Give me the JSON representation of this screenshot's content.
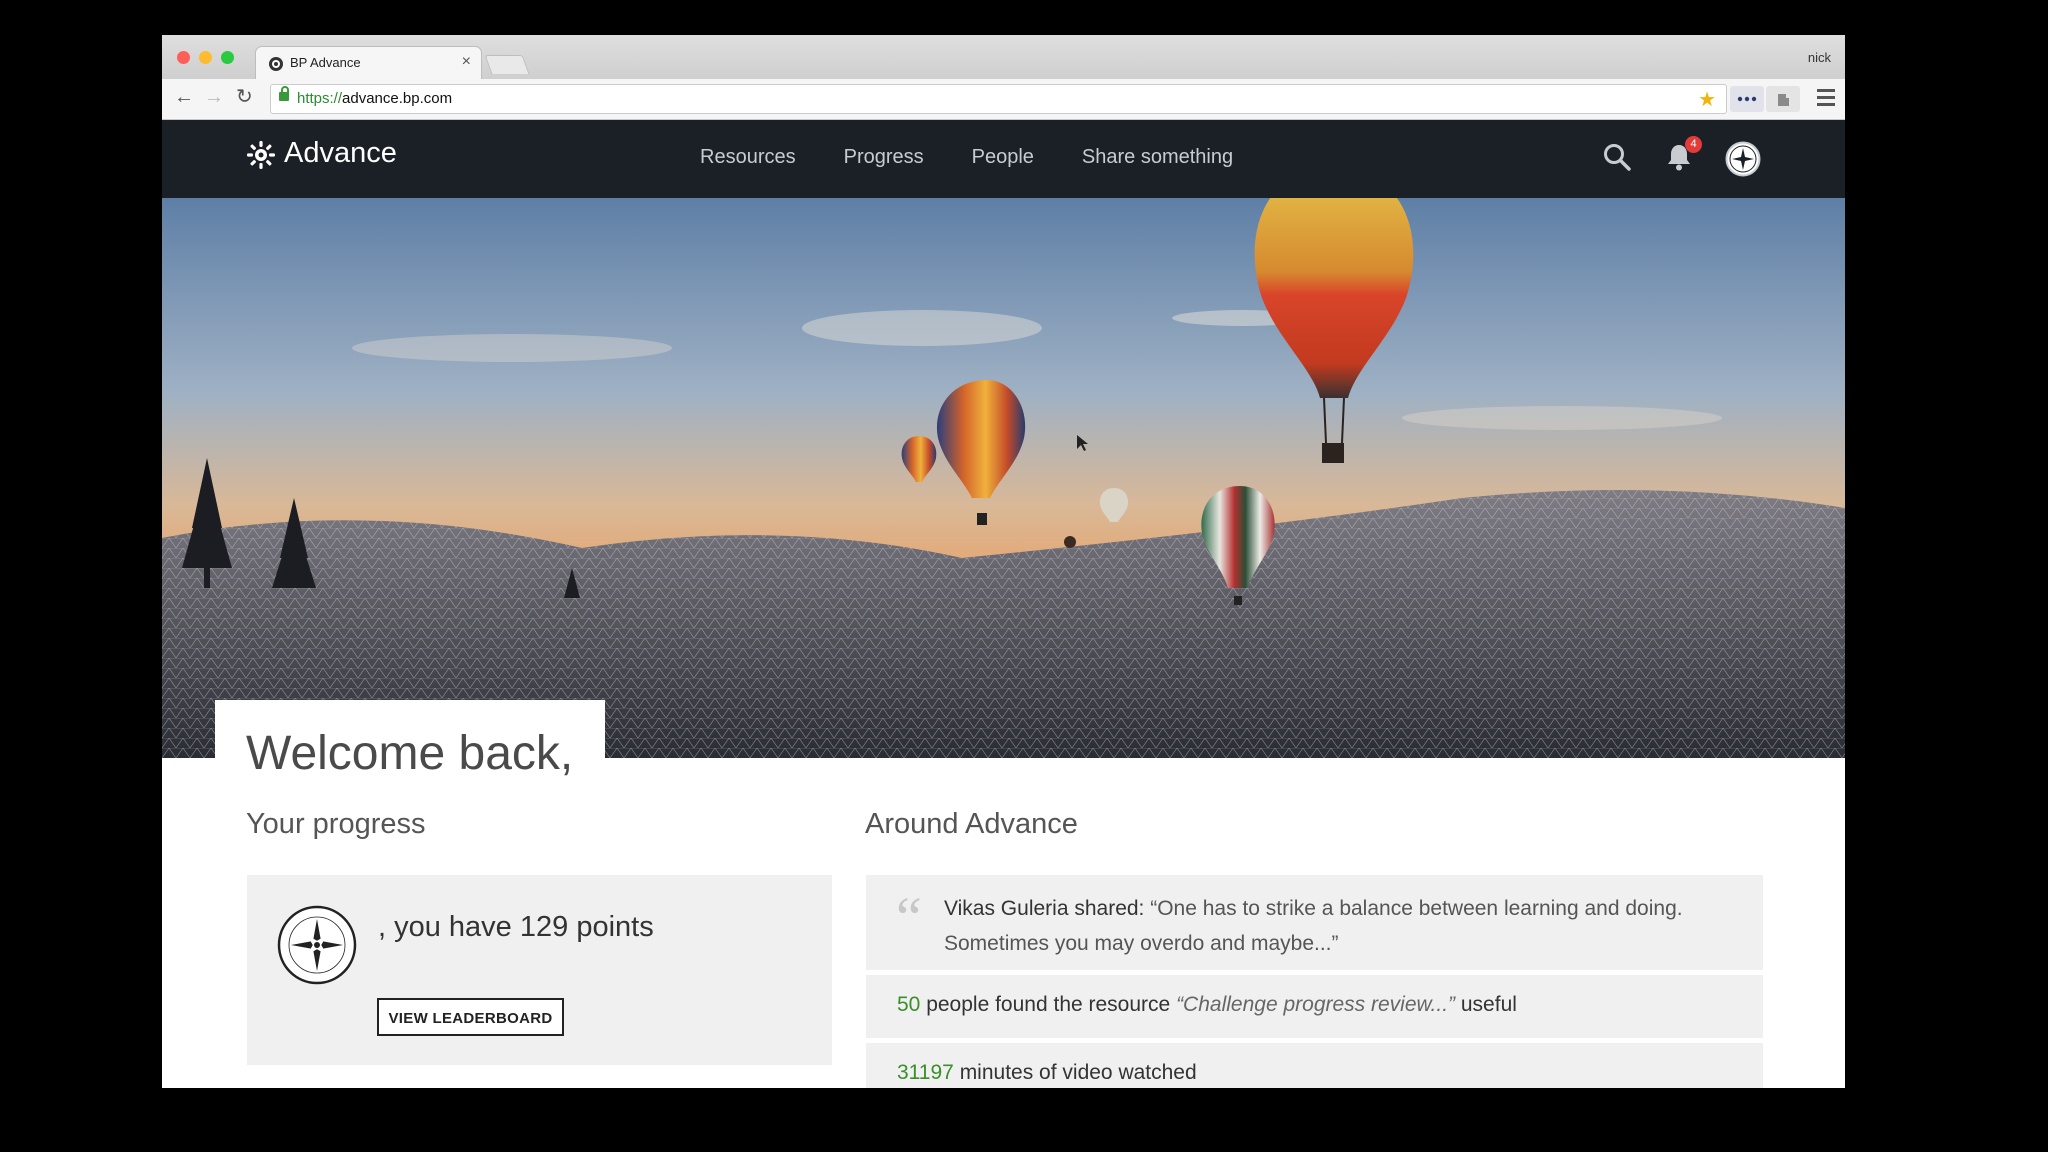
{
  "browser": {
    "tab_title": "BP Advance",
    "tab_close": "×",
    "profile": "nick",
    "url_scheme": "https://",
    "url_host": "advance.bp.com"
  },
  "nav": {
    "logo": "Advance",
    "links": [
      "Resources",
      "Progress",
      "People",
      "Share something"
    ],
    "notifications": "4"
  },
  "hero": {
    "welcome": "Welcome back,"
  },
  "progress": {
    "heading": "Your progress",
    "points_text": ", you have 129 points",
    "leaderboard_button": "VIEW LEADERBOARD"
  },
  "around": {
    "heading": "Around Advance",
    "share": {
      "author": "Vikas Guleria shared:",
      "quote": "“One has to strike a balance between learning and doing. Sometimes you may overdo and maybe...”"
    },
    "resource": {
      "count": "50",
      "text": "people found the resource",
      "title": "“Challenge progress review...”",
      "suffix": "useful"
    },
    "video": {
      "count": "31197",
      "text": "minutes of video watched"
    }
  },
  "colors": {
    "nav_bg": "#1b2026",
    "accent_green": "#3a8f2a",
    "badge_red": "#e43a3a"
  }
}
